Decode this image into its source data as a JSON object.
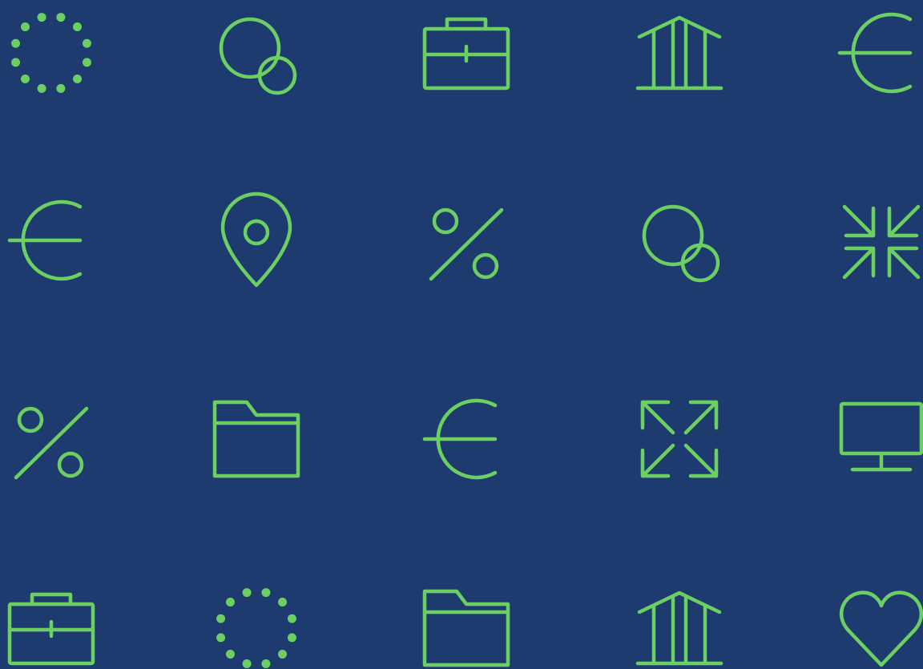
{
  "colors": {
    "background": "#1e3b6f",
    "icon_stroke": "#6ccf62"
  },
  "icons": [
    [
      "dotted-circle-icon",
      "overlapping-circles-icon",
      "briefcase-icon",
      "bank-icon",
      "euro-icon"
    ],
    [
      "euro-icon",
      "location-pin-icon",
      "percent-icon",
      "overlapping-circles-icon",
      "collapse-arrows-icon"
    ],
    [
      "percent-icon",
      "folder-icon",
      "euro-icon",
      "expand-arrows-icon",
      "monitor-icon"
    ],
    [
      "briefcase-icon",
      "dotted-circle-icon",
      "folder-icon",
      "bank-icon",
      "heart-icon"
    ]
  ]
}
